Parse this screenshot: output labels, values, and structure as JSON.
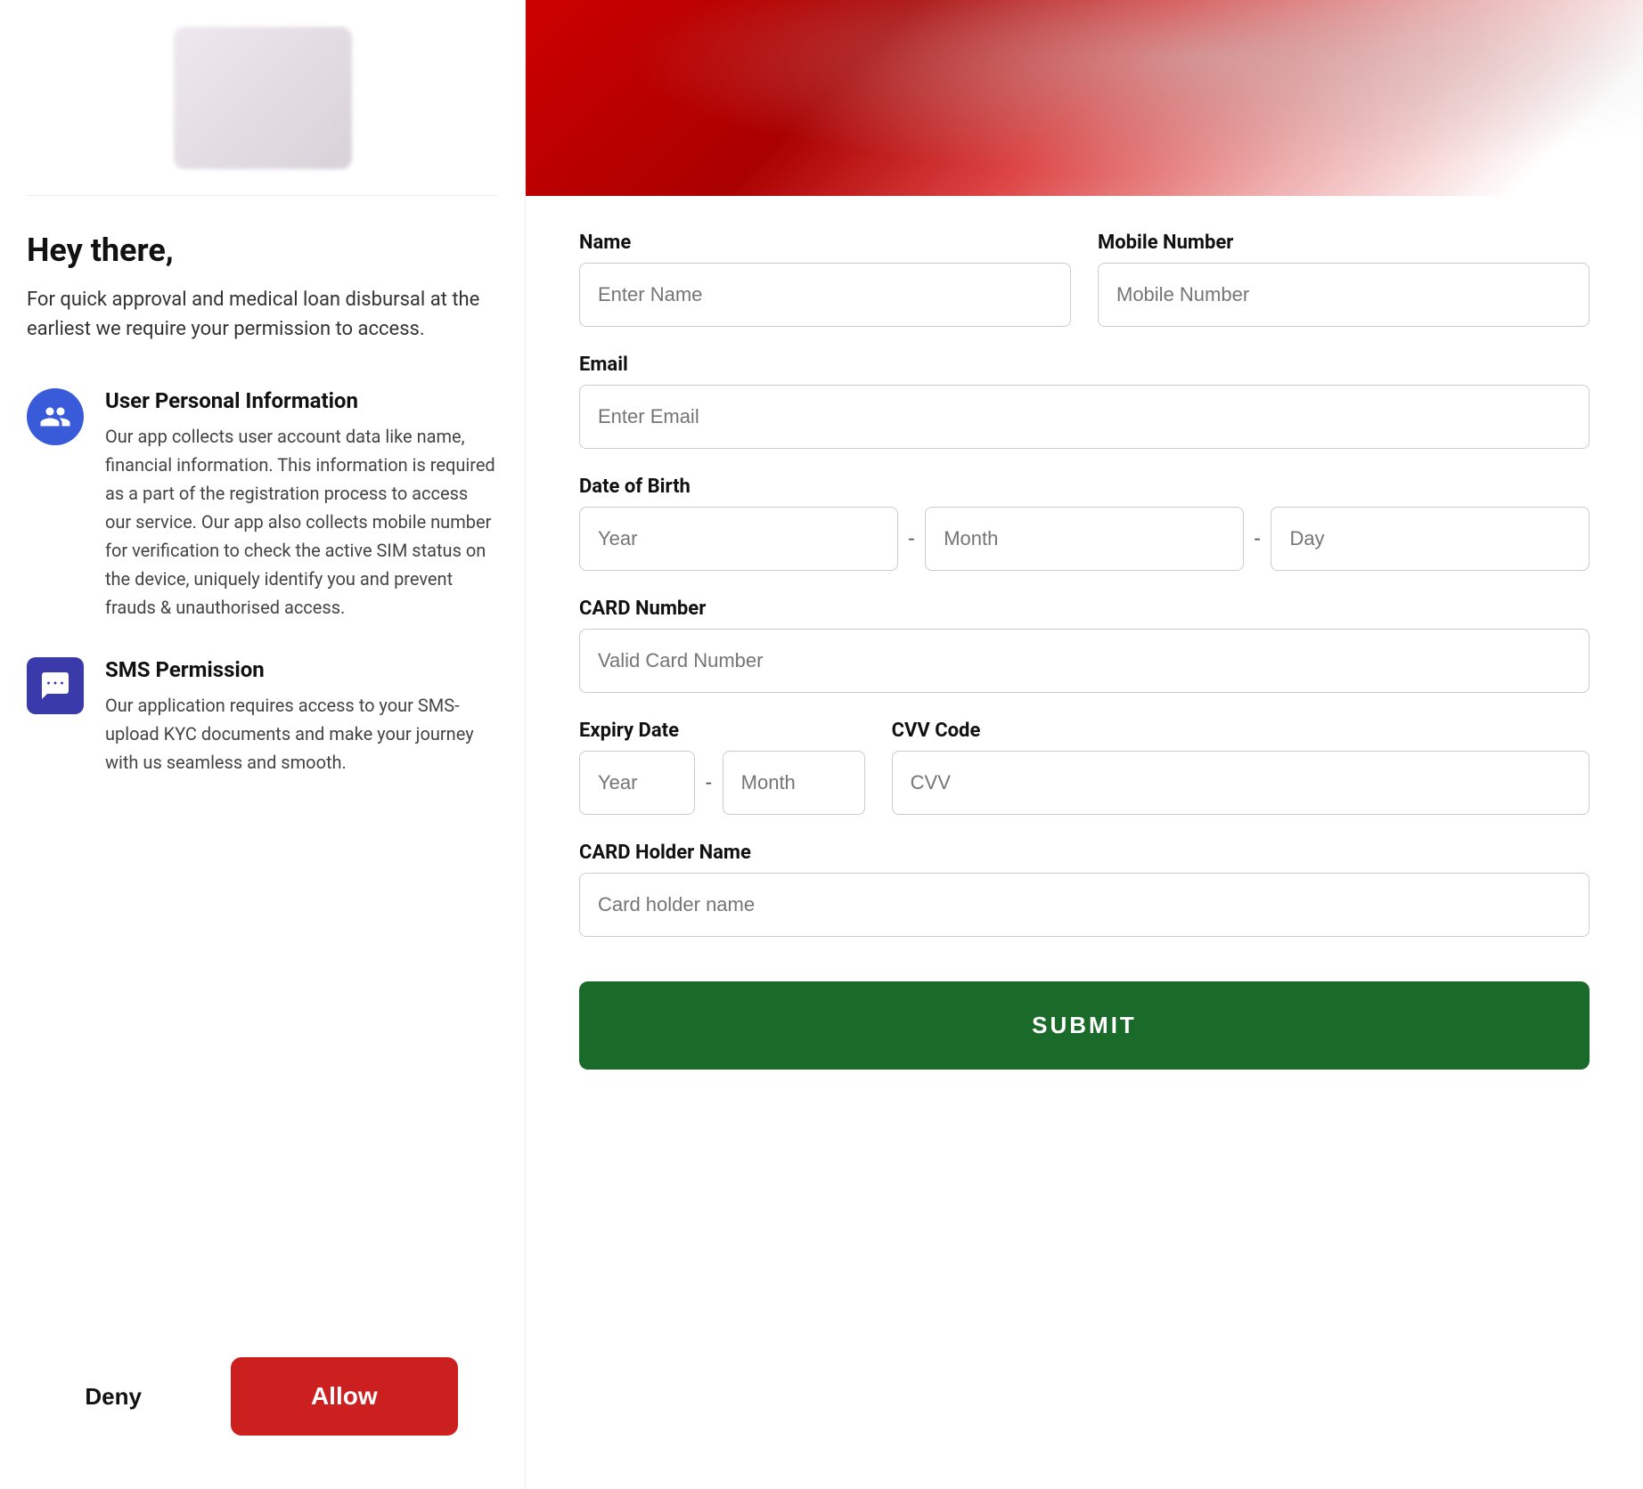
{
  "left": {
    "greeting": "Hey there,",
    "intro": "For quick approval and medical loan disbursal at the earliest we require your permission to access.",
    "permissions": [
      {
        "icon_type": "person",
        "title": "User Personal Information",
        "description": "Our app collects user account data like name, financial information. This information is required as a part of the registration process to access our service. Our app also collects mobile number for verification to check the active SIM status on the device, uniquely identify you and prevent frauds & unauthorised access."
      },
      {
        "icon_type": "sms",
        "title": "SMS Permission",
        "description": "Our application requires access to your SMS-upload KYC documents and make your journey with us seamless and smooth."
      }
    ],
    "deny_label": "Deny",
    "allow_label": "Allow"
  },
  "right": {
    "form": {
      "name_label": "Name",
      "name_placeholder": "Enter Name",
      "mobile_label": "Mobile Number",
      "mobile_placeholder": "Mobile Number",
      "email_label": "Email",
      "email_placeholder": "Enter Email",
      "dob_label": "Date of Birth",
      "dob_year_placeholder": "Year",
      "dob_month_placeholder": "Month",
      "dob_day_placeholder": "Day",
      "card_number_label": "CARD Number",
      "card_number_placeholder": "Valid Card Number",
      "expiry_label": "Expiry Date",
      "expiry_year_placeholder": "Year",
      "expiry_month_placeholder": "Month",
      "cvv_label": "CVV Code",
      "cvv_placeholder": "CVV",
      "card_holder_label": "CARD Holder Name",
      "card_holder_placeholder": "Card holder name",
      "submit_label": "SUBMIT"
    }
  }
}
